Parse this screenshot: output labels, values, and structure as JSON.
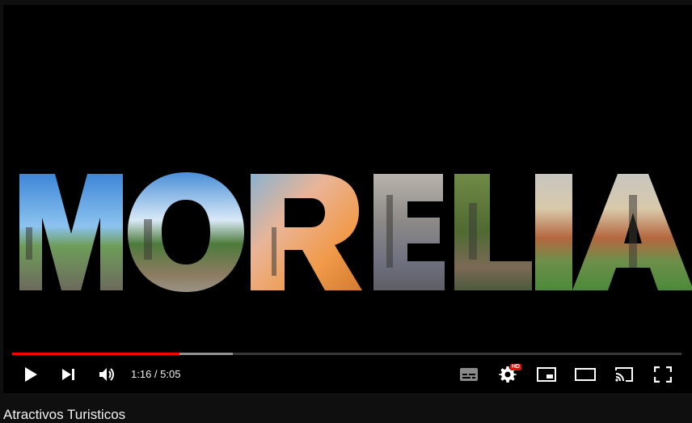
{
  "video": {
    "title_text": "MORELIA",
    "time_display": "1:16 / 5:05",
    "progress_played_fraction": 0.25,
    "progress_buffered_fraction": 0.33
  },
  "controls": {
    "play": "play-icon",
    "next": "next-icon",
    "volume": "volume-icon",
    "subtitles": "subtitles-icon",
    "settings": "settings-icon",
    "settings_badge": "HD",
    "miniplayer": "miniplayer-icon",
    "theater": "theater-mode-icon",
    "cast": "cast-icon",
    "fullscreen": "fullscreen-icon"
  },
  "page": {
    "video_heading": "Atractivos Turisticos"
  },
  "colors": {
    "progress_played": "#ff0000",
    "player_bg": "#000000",
    "page_bg": "#0f0f0f"
  }
}
